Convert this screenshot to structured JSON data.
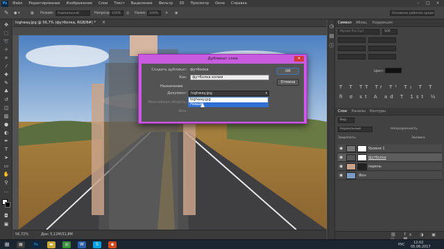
{
  "menubar": {
    "logo": "Ps",
    "items": [
      "Файл",
      "Редактирование",
      "Изображение",
      "Слои",
      "Текст",
      "Выделение",
      "Фильтр",
      "3D",
      "Просмотр",
      "Окно",
      "Справка"
    ],
    "workspace_hint": "Основное рабочее среда"
  },
  "options": {
    "style": "Нормальный",
    "opacity_label": "Непрозр.:",
    "opacity": "100%",
    "flow_label": "Нажм.:",
    "flow": "100%"
  },
  "document": {
    "tab_title": "highway.jpg @ 56,7% (футболка, RGB/8#) *"
  },
  "status": {
    "zoom": "56,72%",
    "doc_size": "Док: 5,12М/31,8М"
  },
  "right_panel": {
    "top_tabs": [
      "Символ",
      "Абзац",
      "Коррекция"
    ],
    "font": "Myriad Pro Cyrl",
    "font_size": "500",
    "color_label": "Цвет:",
    "layer_tabs": [
      "Слои",
      "Каналы",
      "Контуры"
    ],
    "kind": "Вид",
    "blend": "Нормальный",
    "opacity_label": "Непрозрачность",
    "lock_label": "Закрепить:",
    "fill_label": "Заливка",
    "layers": [
      {
        "name": "Уровни 1"
      },
      {
        "name": "футболка"
      },
      {
        "name": "парень"
      },
      {
        "name": "Фон"
      }
    ]
  },
  "dialog": {
    "title": "Дубликат слоя",
    "close_symbol": "×",
    "source_label": "Создать дубликат:",
    "source_value": "футболка",
    "as_label": "Как:",
    "as_value": "футболка копия",
    "destination_label": "Назначение",
    "document_label": "Документ:",
    "document_value": "highway.jpg",
    "artboard_label": "Монтажная область:",
    "name_label": "Имя:",
    "ok_label": "ОК",
    "cancel_label": "Отмена",
    "dropdown_options": [
      "highway.jpg",
      "Новый"
    ]
  },
  "taskbar": {
    "lang": "РУС",
    "time": "12:02",
    "date": "05.06.2017"
  },
  "colors": {
    "dialog_frame": "#c85be0",
    "selection": "#2f6fd6",
    "ps_blue": "#31a8ff"
  }
}
